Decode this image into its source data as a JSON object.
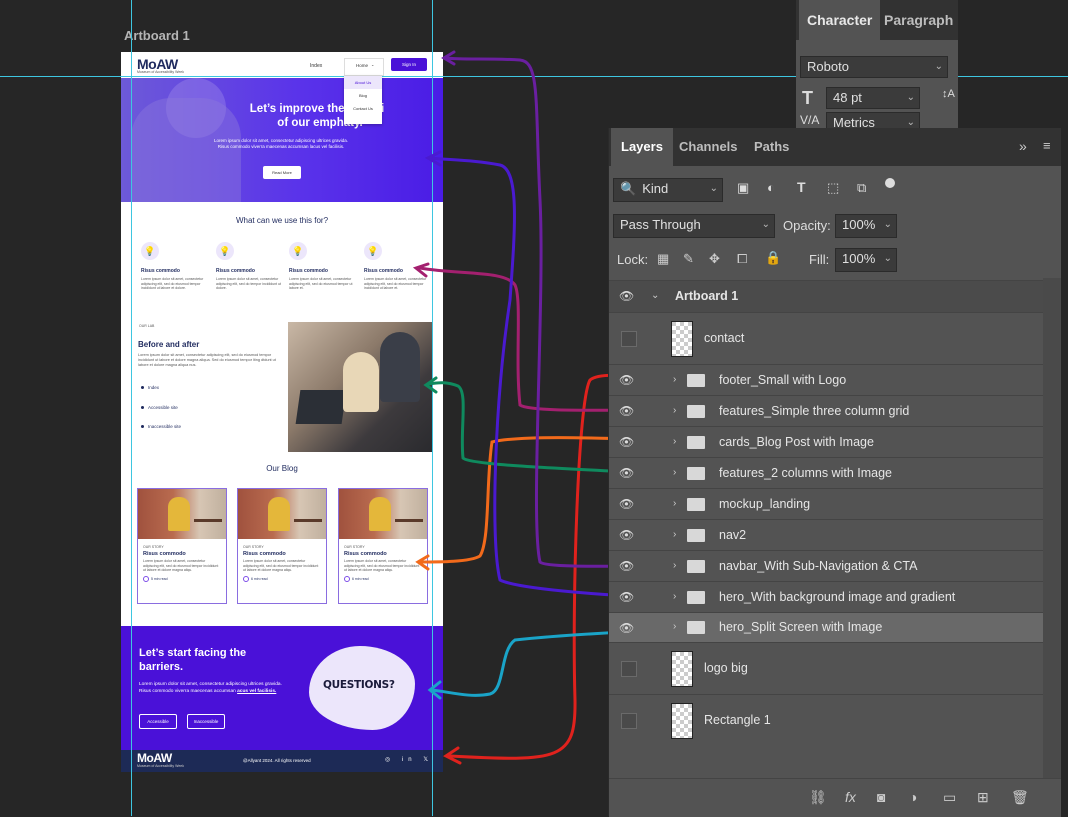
{
  "artboard_label": "Artboard 1",
  "site": {
    "logo": "MoAW",
    "logo_sub": "Museum of Accessibility Week",
    "nav": {
      "index": "Index",
      "home": "Home",
      "signin": "Sign In",
      "dropdown": [
        "About Us",
        "Blog",
        "Contact Us"
      ]
    },
    "hero": {
      "title": "Let’s improve the usabili of our emphaty.",
      "text": "Lorem ipsum dolor sit amet, consectetur adipiscing ultrices gravida. Risus commodo viverra maecenas accumsan lacus vel facilisis.",
      "button": "Read More"
    },
    "features": {
      "title": "What can we use this for?",
      "items": [
        {
          "title": "Risus commodo",
          "text": "Lorem ipsum dolor sit amet, consectetur adipiscing elit, sed do eiusmod tempor incididunt ut labore et dolore."
        },
        {
          "title": "Risus commodo",
          "text": "Lorem ipsum dolor sit amet, consectetur adipiscing elit, sed do tempor incididunt ut dolore."
        },
        {
          "title": "Risus commodo",
          "text": "Lorem ipsum dolor sit amet, consectetur adipiscing elit, sed do eiusmod tempor ut labore et."
        },
        {
          "title": "Risus commodo",
          "text": "Lorem ipsum dolor sit amet, consectetur adipiscing elit, sed do eiusmod tempor incididunt ut labore et."
        }
      ]
    },
    "lab": {
      "eyebrow": "OUR LAB",
      "title": "Before and after",
      "text": "Lorem ipsum dolor sit amet, consectetur adipiscing elit, sed do eiusmod tempor incididunt ut labore et dolore magna aliqua. Sed do eiusmod tempor lting dtdunt ut labore et dolore magna aliqua nus.",
      "list": [
        "Index",
        "Accessible site",
        "Inaccessible site"
      ]
    },
    "blog": {
      "title": "Our Blog",
      "cards": [
        {
          "eyebrow": "OUR STORY",
          "title": "Risus commodo",
          "text": "Lorem ipsum dolor sit amet, consectetur adipiscing elit, sed do eiusmod tempor incididunt ut labore et dolore magna aliqu.",
          "read": "5 min read"
        },
        {
          "eyebrow": "OUR STORY",
          "title": "Risus commodo",
          "text": "Lorem ipsum dolor sit amet, consectetur adipiscing elit, sed do eiusmod tempor incididunt ut labore et dolore magna aliqu.",
          "read": "6 min read"
        },
        {
          "eyebrow": "OUR STORY",
          "title": "Risus commodo",
          "text": "Lorem ipsum dolor sit amet, consectetur adipiscing elit, sed do eiusmod tempor incididunt ut labore et dolore magna aliqu.",
          "read": "6 min read"
        }
      ]
    },
    "cta": {
      "title": "Let’s start facing the barriers.",
      "text": "Lorem ipsum dolor sit amet, consectetur adipiscing ultrices gravida. Risus commodo viverra maecenas accumsan",
      "text_link": "acus vel facilisis.",
      "btn1": "Accessible",
      "btn2": "Inaccessible",
      "blob": "QUESTIONS?"
    },
    "footer": {
      "copy": "@Allyant 2024. All rights reserved",
      "icons": "◎ in 𝕏"
    }
  },
  "character_panel": {
    "tabs": [
      "Character",
      "Paragraph"
    ],
    "font": "Roboto",
    "size": "48 pt",
    "kerning": "Metrics"
  },
  "layers_panel": {
    "tabs": [
      "Layers",
      "Channels",
      "Paths"
    ],
    "filter": "Kind",
    "blend": "Pass Through",
    "opacity_label": "Opacity:",
    "opacity": "100%",
    "lock_label": "Lock:",
    "fill_label": "Fill:",
    "fill": "100%",
    "artboard": "Artboard 1",
    "layers": [
      {
        "name": "contact",
        "kind": "thumb",
        "visible": false
      },
      {
        "name": "footer_Small with Logo",
        "kind": "folder",
        "visible": true
      },
      {
        "name": "features_Simple three column grid",
        "kind": "folder",
        "visible": true
      },
      {
        "name": "cards_Blog Post with Image",
        "kind": "folder",
        "visible": true
      },
      {
        "name": "features_2 columns with Image",
        "kind": "folder",
        "visible": true
      },
      {
        "name": "mockup_landing",
        "kind": "folder",
        "visible": true
      },
      {
        "name": "nav2",
        "kind": "folder",
        "visible": true
      },
      {
        "name": "navbar_With Sub-Navigation & CTA",
        "kind": "folder",
        "visible": true
      },
      {
        "name": "hero_With background image and gradient",
        "kind": "folder",
        "visible": true
      },
      {
        "name": "hero_Split Screen with Image",
        "kind": "folder",
        "visible": true,
        "selected": true
      },
      {
        "name": "logo big",
        "kind": "thumb",
        "visible": false
      },
      {
        "name": "Rectangle 1",
        "kind": "thumb",
        "visible": false
      }
    ]
  },
  "annotation_colors": [
    "#e0221d",
    "#a3206f",
    "#f26a1b",
    "#0f8a5e",
    "#6a1fa0",
    "#4a1ad0",
    "#1aa4c8"
  ]
}
